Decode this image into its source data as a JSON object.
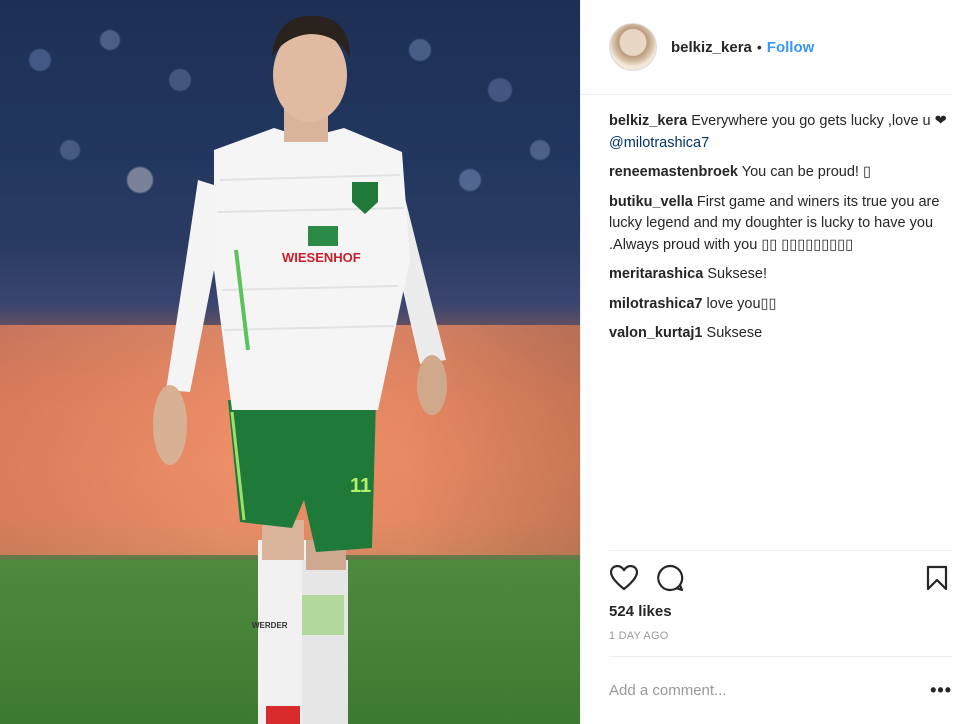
{
  "post": {
    "author": {
      "username": "belkiz_kera",
      "separator": "•",
      "follow_label": "Follow"
    },
    "jersey": {
      "sponsor": "WIESENHOF",
      "number": "11",
      "sock_text": "WERDER"
    },
    "comments": [
      {
        "user": "belkiz_kera",
        "text": "Everywhere you go gets lucky ,love u ❤ ",
        "mention": "@milotrashica7"
      },
      {
        "user": "reneemastenbroek",
        "text": "You can be proud! ▯",
        "mention": ""
      },
      {
        "user": "butiku_vella",
        "text": "First game and winers its true you are lucky legend and my doughter is lucky to have you .Always proud with you ▯▯ ▯▯▯▯▯▯▯▯▯",
        "mention": ""
      },
      {
        "user": "meritarashica",
        "text": "Suksese!",
        "mention": ""
      },
      {
        "user": "milotrashica7",
        "text": "love you▯▯",
        "mention": ""
      },
      {
        "user": "valon_kurtaj1",
        "text": "Suksese",
        "mention": ""
      }
    ],
    "icons": [
      "heart-icon",
      "comment-icon",
      "bookmark-icon",
      "more-icon"
    ],
    "likes_label": "524 likes",
    "timestamp": "1 DAY AGO",
    "add_comment_placeholder": "Add a comment...",
    "more_label": "•••"
  },
  "colors": {
    "link": "#3897f0",
    "text": "#262626",
    "muted": "#999999",
    "jersey_green": "#1f7a3a",
    "divider": "#efefef"
  }
}
